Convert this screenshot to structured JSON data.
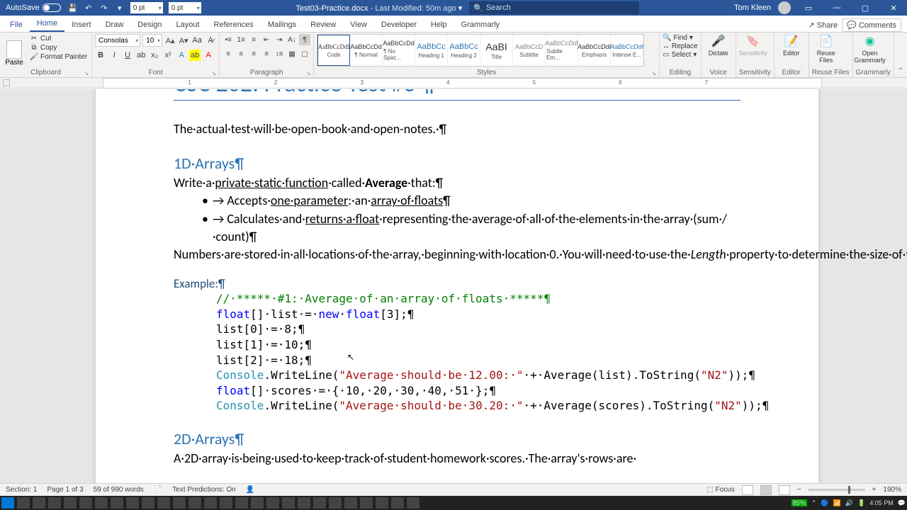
{
  "titlebar": {
    "autosave": "AutoSave",
    "spin1": "0 pt",
    "spin2": "0 pt",
    "docname": "Test03-Practice.docx",
    "modified": "- Last Modified: 50m ago",
    "search_placeholder": "Search",
    "user": "Tom Kleen"
  },
  "tabs": {
    "file": "File",
    "home": "Home",
    "insert": "Insert",
    "draw": "Draw",
    "design": "Design",
    "layout": "Layout",
    "references": "References",
    "mailings": "Mailings",
    "review": "Review",
    "view": "View",
    "developer": "Developer",
    "help": "Help",
    "grammarly": "Grammarly",
    "share": "Share",
    "comments": "Comments"
  },
  "ribbon": {
    "clipboard": {
      "label": "Clipboard",
      "paste": "Paste",
      "cut": "Cut",
      "copy": "Copy",
      "fmt": "Format Painter"
    },
    "font": {
      "label": "Font",
      "name": "Consolas",
      "size": "10"
    },
    "paragraph": {
      "label": "Paragraph"
    },
    "styles": {
      "label": "Styles",
      "items": [
        {
          "prev": "AaBbCcDdI",
          "name": "Code"
        },
        {
          "prev": "AaBbCcDd",
          "name": "¶ Normal"
        },
        {
          "prev": "AaBbCcDd",
          "name": "¶ No Spac..."
        },
        {
          "prev": "AaBbCc",
          "name": "Heading 1"
        },
        {
          "prev": "AaBbCc",
          "name": "Heading 2"
        },
        {
          "prev": "AaBI",
          "name": "Title"
        },
        {
          "prev": "AaBbCcD",
          "name": "Subtitle"
        },
        {
          "prev": "AaBbCcDdI",
          "name": "Subtle Em..."
        },
        {
          "prev": "AaBbCcDdI",
          "name": "Emphasis"
        },
        {
          "prev": "AaBbCcDdI",
          "name": "Intense E..."
        }
      ]
    },
    "editing": {
      "label": "Editing",
      "find": "Find",
      "replace": "Replace",
      "select": "Select"
    },
    "voice": {
      "label": "Voice",
      "dictate": "Dictate"
    },
    "sensitivity": {
      "label": "Sensitivity",
      "btn": "Sensitivity"
    },
    "editor": {
      "label": "Editor",
      "btn": "Editor"
    },
    "reuse": {
      "label": "Reuse Files",
      "btn": "Reuse\nFiles"
    },
    "grammarly": {
      "label": "Grammarly",
      "btn": "Open\nGrammarly"
    }
  },
  "doc": {
    "intro": "The·actual·test·will·be·open-book·and·open-notes.·¶",
    "h1": "1D·Arrays¶",
    "p1a": "Write·a·",
    "p1b": "private·static·function",
    "p1c": "·called·",
    "p1d": "Average",
    "p1e": "·that:¶",
    "b1a": "→ Accepts·",
    "b1b": "one·parameter",
    "b1c": ":·an·",
    "b1d": "array·of·floats",
    "b1e": "¶",
    "b2a": "→ Calculates·and·",
    "b2b": "returns·a·float",
    "b2c": "·representing·the·average·of·all·of·the·elements·in·the·array·(sum·/·count)¶",
    "p2a": "Numbers·are·stored·in·all·locations·of·the·array,·beginning·with·location·0.·You·will·need·to·use·the·",
    "p2b": "Length",
    "p2c": "·property·to·determine·the·size·of·the·array·(do·this·in·the·function).·¶",
    "ex": "Example:¶",
    "c1": "//·*****·#1:·Average·of·an·array·of·floats·*****¶",
    "c2a": "float",
    "c2b": "[]·list·=·",
    "c2c": "new",
    "c2d": "·",
    "c2e": "float",
    "c2f": "[3];¶",
    "c3": "list[0]·=·8;¶",
    "c4": "list[1]·=·10;¶",
    "c5": "list[2]·=·18;¶",
    "c6a": "Console",
    "c6b": ".WriteLine(",
    "c6c": "\"Average·should·be·12.00:·\"",
    "c6d": "·+·Average(list).ToString(",
    "c6e": "\"N2\"",
    "c6f": "));¶",
    "c7a": "float",
    "c7b": "[]·scores·=·{·10,·20,·30,·40,·51·};¶",
    "c8a": "Console",
    "c8b": ".WriteLine(",
    "c8c": "\"Average·should·be·30.20:·\"",
    "c8d": "·+·Average(scores).ToString(",
    "c8e": "\"N2\"",
    "c8f": "));¶",
    "h2": "2D·Arrays¶",
    "p3": "A·2D·array·is·being·used·to·keep·track·of·student·homework·scores.·The·array's·rows·are·"
  },
  "status": {
    "section": "Section: 1",
    "page": "Page 1 of 3",
    "words": "59 of 990 words",
    "pred": "Text Predictions: On",
    "focus": "Focus",
    "battery": "85%",
    "zoom": "190%",
    "time": "4:05 PM"
  }
}
